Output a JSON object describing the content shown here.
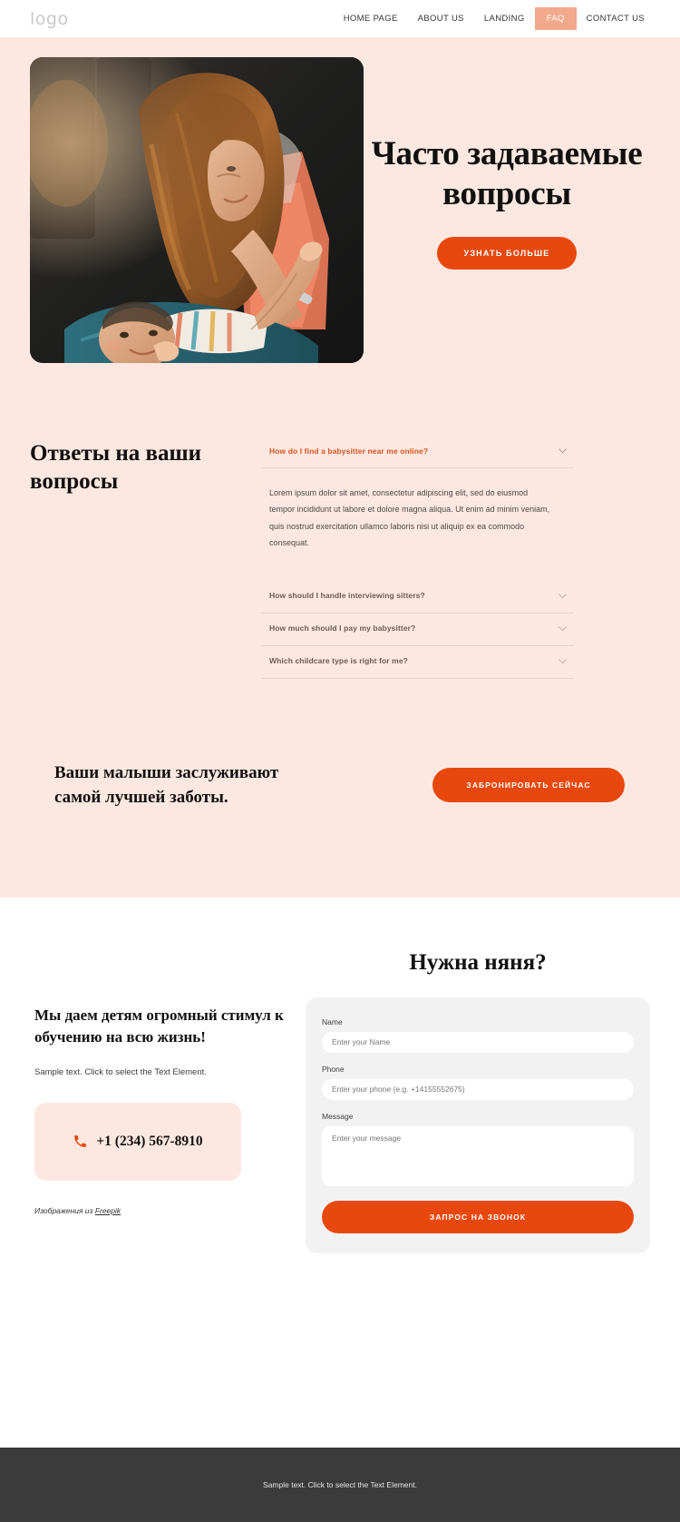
{
  "header": {
    "logo": "logo",
    "nav": [
      {
        "label": "HOME PAGE",
        "active": false
      },
      {
        "label": "ABOUT US",
        "active": false
      },
      {
        "label": "LANDING",
        "active": false
      },
      {
        "label": "FAQ",
        "active": true
      },
      {
        "label": "CONTACT US",
        "active": false
      }
    ]
  },
  "hero": {
    "title": "Часто задаваемые вопросы",
    "cta_label": "УЗНАТЬ БОЛЬШЕ",
    "image_alt": "mother-playing-with-baby-photo"
  },
  "faq": {
    "heading": "Ответы на ваши вопросы",
    "items": [
      {
        "question": "How do I find a babysitter near me online?",
        "answer": "Lorem ipsum dolor sit amet, consectetur adipiscing elit, sed do eiusmod tempor incididunt ut labore et dolore magna aliqua. Ut enim ad minim veniam, quis nostrud exercitation ullamco laboris nisi ut aliquip ex ea commodo consequat.",
        "open": true
      },
      {
        "question": "How should I handle interviewing sitters?",
        "answer": "",
        "open": false
      },
      {
        "question": "How much should I pay my babysitter?",
        "answer": "",
        "open": false
      },
      {
        "question": "Which childcare type is right for me?",
        "answer": "",
        "open": false
      }
    ]
  },
  "cta_band": {
    "text": "Ваши малыши заслуживают самой лучшей заботы.",
    "button_label": "ЗАБРОНИРОВАТЬ СЕЙЧАС"
  },
  "contact": {
    "heading": "Мы даем детям огромный стимул к обучению на всю жизнь!",
    "subtext": "Sample text. Click to select the Text Element.",
    "phone": "+1 (234) 567-8910",
    "credit_prefix": "Изображения из ",
    "credit_link": "Freepik",
    "form": {
      "title": "Нужна няня?",
      "name_label": "Name",
      "name_placeholder": "Enter your Name",
      "phone_label": "Phone",
      "phone_placeholder": "Enter your phone (e.g. +14155552675)",
      "message_label": "Message",
      "message_placeholder": "Enter your message",
      "submit_label": "ЗАПРОС НА ЗВОНОК"
    }
  },
  "footer": {
    "text": "Sample text. Click to select the Text Element."
  },
  "colors": {
    "accent_orange": "#E8480E",
    "peach_bg": "#FDE8E1",
    "nav_active": "#F2A98B",
    "footer_bg": "#3B3B3B",
    "question_active": "#D4551F",
    "question_idle": "#6E5B55"
  }
}
